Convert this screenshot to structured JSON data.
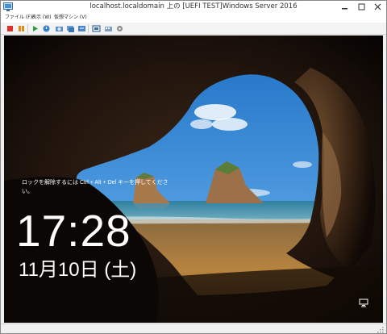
{
  "window": {
    "title": "localhost.localdomain 上の [UEFI TEST]Windows Server 2016"
  },
  "menubar": {
    "items": [
      {
        "label": "ファイル (F)"
      },
      {
        "label": "表示 (W)"
      },
      {
        "label": "仮想マシン (V)"
      }
    ]
  },
  "toolbar": {
    "icons": [
      "stop-icon",
      "pause-icon",
      "play-icon",
      "reset-icon",
      "snapshot-icon",
      "snapshot-manager-icon",
      "fullscreen-icon",
      "send-keys-icon",
      "settings-icon"
    ]
  },
  "lockscreen": {
    "message": "ロックを解除するには Ctrl + Alt + Del キーを押してください。",
    "message_line1": "ロックを解除するには Ctrl + Alt + Del キーを押してくださ",
    "message_line2": "い。",
    "time": "17:28",
    "date": "11月10日 (土)"
  },
  "colors": {
    "sky": "#2f7fcf",
    "sea": "#3f8aa6",
    "sand": "#b07e3e",
    "cave": "#2a1a10",
    "text": "#ffffff"
  }
}
